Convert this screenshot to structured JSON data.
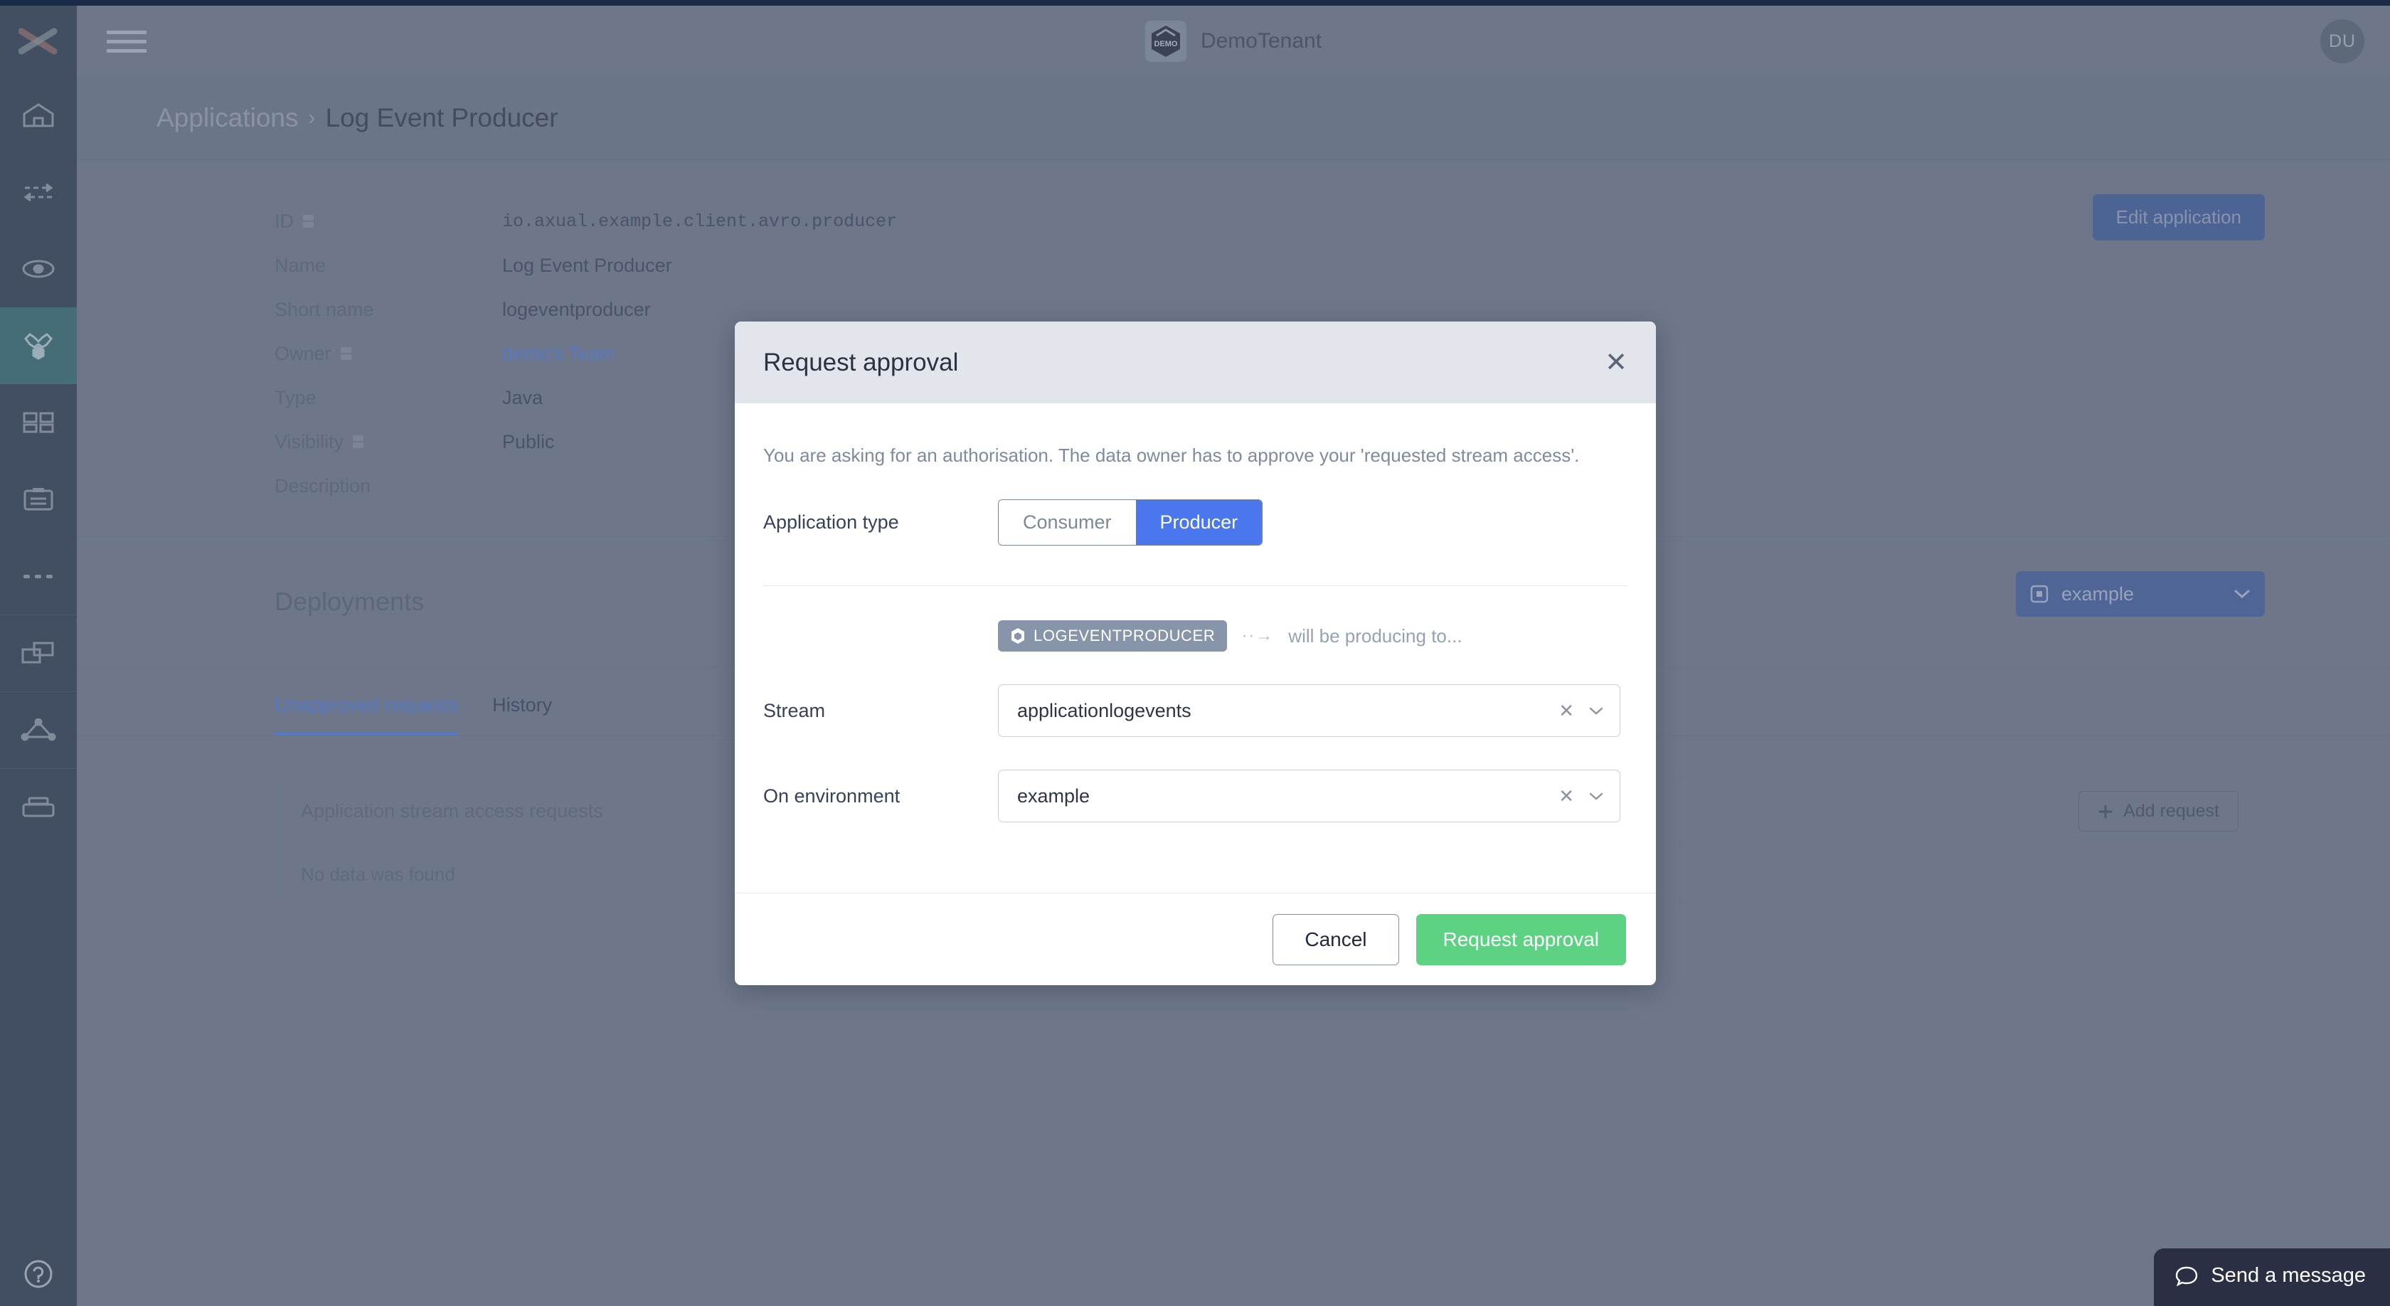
{
  "app": {
    "header": {
      "menu_icon": "hamburger-icon",
      "tenant_logo_text": "DEMO",
      "tenant_name": "DemoTenant",
      "avatar_initials": "DU"
    },
    "sidebar": {
      "logo_icon": "axual-x-logo",
      "items": [
        {
          "icon": "home-icon",
          "active": false
        },
        {
          "icon": "exchange-arrows-icon",
          "active": false
        },
        {
          "icon": "stream-topic-icon",
          "active": false
        },
        {
          "icon": "applications-hex-icon",
          "active": true
        },
        {
          "icon": "dashboard-grid-icon",
          "active": false
        },
        {
          "icon": "schema-card-icon",
          "active": false
        },
        {
          "icon": "ellipsis-icon",
          "active": false
        },
        {
          "icon": "environments-icon",
          "active": false
        },
        {
          "icon": "clusters-icon",
          "active": false
        },
        {
          "icon": "instances-icon",
          "active": false
        }
      ],
      "help_icon": "question-mark-icon"
    },
    "breadcrumb": {
      "parent": "Applications",
      "separator": "›",
      "current": "Log Event Producer"
    },
    "details": {
      "rows": [
        {
          "label": "ID",
          "value": "io.axual.example.client.avro.producer",
          "mono": true,
          "info": true,
          "link": false
        },
        {
          "label": "Name",
          "value": "Log Event Producer",
          "mono": false,
          "info": false,
          "link": false
        },
        {
          "label": "Short name",
          "value": "logeventproducer",
          "mono": false,
          "info": false,
          "link": false
        },
        {
          "label": "Owner",
          "value": "demo's Team",
          "mono": false,
          "info": true,
          "link": true
        },
        {
          "label": "Type",
          "value": "Java",
          "mono": false,
          "info": false,
          "link": false
        },
        {
          "label": "Visibility",
          "value": "Public",
          "mono": false,
          "info": true,
          "link": false
        },
        {
          "label": "Description",
          "value": "",
          "mono": false,
          "info": false,
          "link": false
        }
      ],
      "edit_button": "Edit application"
    },
    "deployments": {
      "title": "Deployments",
      "environment_icon": "environment-icon",
      "environment_value": "example",
      "chevron_icon": "chevron-down-icon"
    },
    "tabs": [
      {
        "label": "Unapproved requests",
        "active": true
      },
      {
        "label": "History",
        "active": false
      }
    ],
    "table": {
      "title": "Application stream access requests",
      "add_button": "Add request",
      "add_icon": "plus-icon",
      "empty_text": "No data was found"
    },
    "chat": {
      "icon": "chat-bubble-icon",
      "label": "Send a message"
    }
  },
  "modal": {
    "title": "Request approval",
    "close_icon": "close-icon",
    "note": "You are asking for an authorisation. The data owner has to approve your 'requested stream access'.",
    "application_type": {
      "label": "Application type",
      "options": [
        "Consumer",
        "Producer"
      ],
      "selected": "Producer"
    },
    "flow": {
      "badge_icon": "application-hex-icon",
      "badge_label": "LOGEVENTPRODUCER",
      "arrow": "··→",
      "note": "will be producing to..."
    },
    "fields": [
      {
        "label": "Stream",
        "value": "applicationlogevents",
        "clear_icon": "clear-x-icon",
        "chevron_icon": "chevron-down-icon"
      },
      {
        "label": "On environment",
        "value": "example",
        "clear_icon": "clear-x-icon",
        "chevron_icon": "chevron-down-icon"
      }
    ],
    "footer": {
      "cancel": "Cancel",
      "submit": "Request approval"
    }
  },
  "colors": {
    "accent_blue": "#4a77ee",
    "success_green": "#5dd283",
    "sidebar_bg": "#424f63",
    "sidebar_active": "#456d78",
    "page_overlay": "#6d7789",
    "modal_header": "#e2e5ec",
    "link": "#5a79c2"
  }
}
